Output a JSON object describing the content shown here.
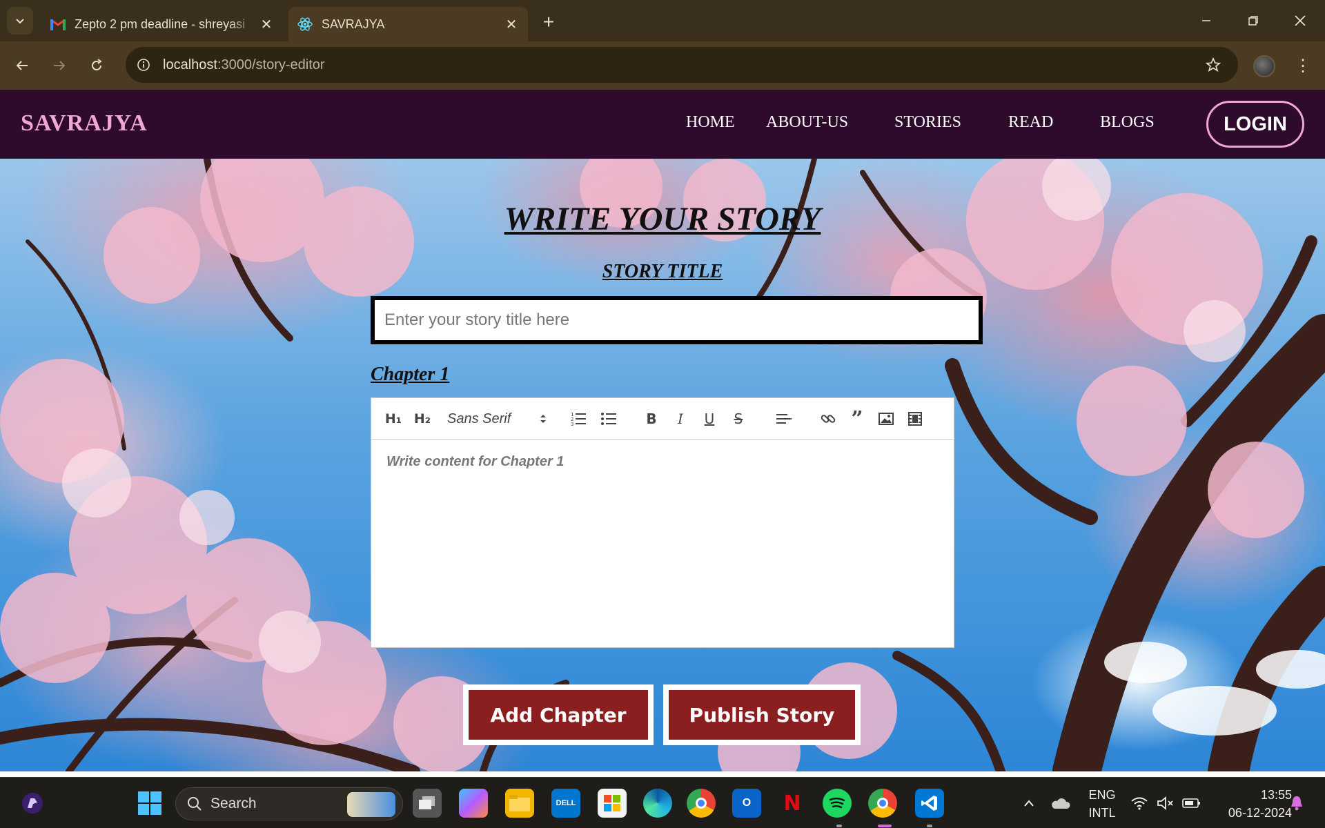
{
  "browser": {
    "tabs": [
      {
        "title": "Zepto 2 pm deadline - shreyasi",
        "favicon": "gmail-icon",
        "active": false
      },
      {
        "title": "SAVRAJYA",
        "favicon": "react-icon",
        "active": true
      }
    ],
    "address": {
      "host": "localhost",
      "rest": ":3000/story-editor"
    }
  },
  "site": {
    "brand": "SAVRAJYA",
    "nav": [
      "HOME",
      "ABOUT-US",
      "STORIES",
      "READ",
      "BLOGS"
    ],
    "login_label": "LOGIN"
  },
  "editor_page": {
    "heading": "WRITE YOUR STORY",
    "story_title_label": "STORY TITLE",
    "title_placeholder": "Enter your story title here",
    "title_value": "",
    "chapter_label": "Chapter 1",
    "toolbar": {
      "h1": "H₁",
      "h2": "H₂",
      "font": "Sans Serif",
      "buttons": [
        "ordered-list-icon",
        "bullet-list-icon",
        "bold-icon",
        "italic-icon",
        "underline-icon",
        "strike-icon",
        "align-icon",
        "link-icon",
        "quote-icon",
        "image-icon",
        "video-icon"
      ]
    },
    "content_placeholder": "Write content for Chapter 1",
    "add_chapter_label": "Add Chapter",
    "publish_label": "Publish Story",
    "colors": {
      "nav_bg": "#2e0a2c",
      "brand": "#f0a7d4",
      "button_bg": "#8b1f1f"
    }
  },
  "taskbar": {
    "search_label": "Search",
    "lang_top": "ENG",
    "lang_bottom": "INTL",
    "time": "13:55",
    "date": "06-12-2024"
  }
}
